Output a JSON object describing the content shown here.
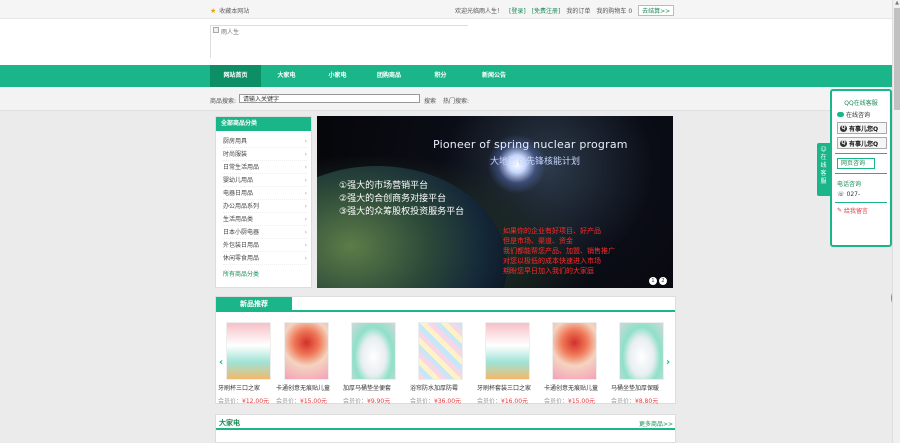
{
  "topbar": {
    "favorite": "收藏本网站",
    "welcome": "欢迎光临雨人生！",
    "login": "[登录]",
    "register": "[免费注册]",
    "my_orders": "我的订单",
    "cart": "我的购物车 0",
    "checkout": "去结算>>"
  },
  "header": {
    "logo_alt": "雨人生"
  },
  "nav": {
    "items": [
      "网站首页",
      "大家电",
      "小家电",
      "团购商品",
      "积分",
      "新闻公告"
    ]
  },
  "search": {
    "label": "商品搜索:",
    "value": "请输入关键字",
    "button": "搜索",
    "hot": "热门搜索:"
  },
  "categories": {
    "title": "全部商品分类",
    "items": [
      "厨房用具",
      "时尚服装",
      "日常生活用品",
      "婴幼儿用品",
      "电器日用品",
      "办公用品系列",
      "生活用品类",
      "日本小厨电器",
      "外包装日用品",
      "休闲零食用品"
    ],
    "all": "所有商品分类"
  },
  "banner": {
    "title_en": "Pioneer of spring nuclear program",
    "title_cn": "大地回春先锋核能计划",
    "points": [
      "①强大的市场营销平台",
      "②强大的合创商务对接平台",
      "③强大的众筹股权投资服务平台"
    ],
    "red_lines": [
      "如果你的企业有好项目、好产品",
      "但是市场、渠道、资金",
      "我们都能帮您产品、加盟、销售推广",
      "对您以极低的成本快速进入市场",
      "期盼您早日加入我们的大家庭"
    ],
    "dots": [
      "1",
      "2"
    ]
  },
  "new_products": {
    "title": "新品推荐",
    "arrow_left": "‹",
    "arrow_right": "›",
    "items": [
      {
        "name": "牙刷杯三口之家",
        "price_label": "会员价：",
        "price": "¥12.00元"
      },
      {
        "name": "卡通创意无痕贴儿童",
        "price_label": "会员价：",
        "price": "¥15.00元"
      },
      {
        "name": "加厚马桶垫坐便套",
        "price_label": "会员价：",
        "price": "¥9.90元"
      },
      {
        "name": "浴帘防水加厚防霉",
        "price_label": "会员价：",
        "price": "¥36.00元"
      },
      {
        "name": "牙刷杯套装三口之家",
        "price_label": "会员价：",
        "price": "¥16.00元"
      },
      {
        "name": "卡通创意无痕贴儿童",
        "price_label": "会员价：",
        "price": "¥15.00元"
      },
      {
        "name": "马桶坐垫加厚保暖",
        "price_label": "会员价：",
        "price": "¥8.80元"
      }
    ]
  },
  "section2": {
    "title": "大家电",
    "more": "更多商品>>"
  },
  "service": {
    "tab": "在线客服",
    "title": "QQ在线客服",
    "online": "在线咨询",
    "qq1": "有事儿您Q",
    "qq2": "有事儿您Q",
    "web": "网页咨询",
    "phone_title": "电话咨询",
    "phone": "027-",
    "message": "给我留言"
  },
  "colors": {
    "accent": "#1bb58a",
    "accent_dark": "#0d8f66",
    "price_red": "#e4393c",
    "link_green": "#1a8b55"
  }
}
